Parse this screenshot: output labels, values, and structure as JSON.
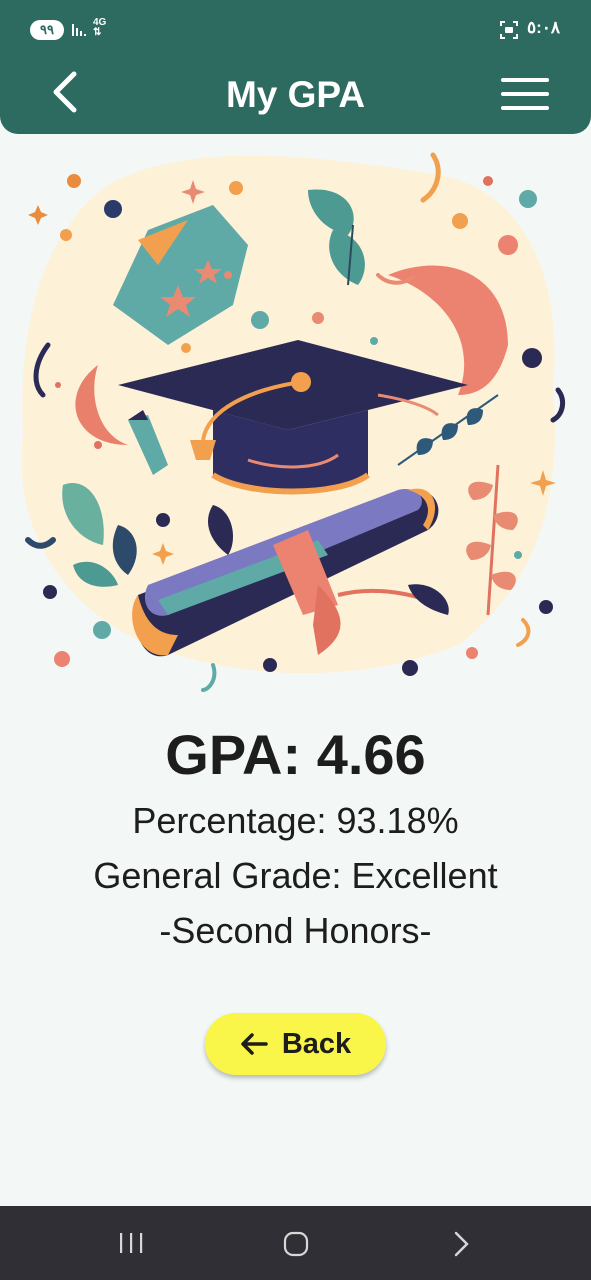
{
  "status_bar": {
    "battery": "٩٩",
    "network": "4G",
    "time": "٥:٠٨",
    "icons": [
      "signal-icon",
      "screen-icon"
    ]
  },
  "app_bar": {
    "title": "My GPA",
    "icons": [
      "back-arrow-icon",
      "menu-icon"
    ]
  },
  "illustration": {
    "subject": "graduation-cap-and-diploma-illustration"
  },
  "result": {
    "gpa": "GPA: 4.66",
    "percentage": "Percentage: 93.18%",
    "grade": "General Grade: Excellent",
    "honors": "-Second Honors-"
  },
  "back_button": {
    "label": "Back",
    "color": "#f9f649",
    "icon": "arrow-left-icon"
  },
  "nav_bar": {
    "icons": [
      "recent-apps-icon",
      "home-icon",
      "back-icon"
    ]
  },
  "colors": {
    "primary": "#2d6a60",
    "background": "#f3f8f6",
    "nav_bar": "#2f2f35"
  }
}
